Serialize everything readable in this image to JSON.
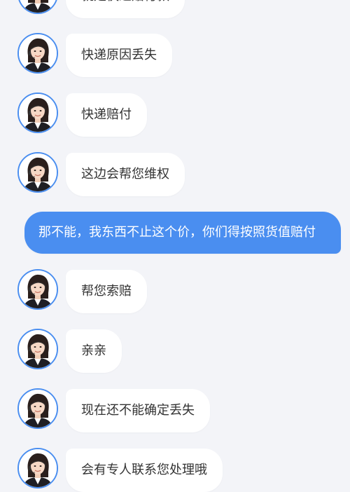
{
  "messages": [
    {
      "sender": "agent",
      "text": "就是快递赔付款"
    },
    {
      "sender": "agent",
      "text": "快递原因丢失"
    },
    {
      "sender": "agent",
      "text": "快递赔付"
    },
    {
      "sender": "agent",
      "text": "这边会帮您维权"
    },
    {
      "sender": "user",
      "text": "那不能，我东西不止这个价，你们得按照货值赔付"
    },
    {
      "sender": "agent",
      "text": "帮您索赔"
    },
    {
      "sender": "agent",
      "text": "亲亲"
    },
    {
      "sender": "agent",
      "text": "现在还不能确定丢失"
    },
    {
      "sender": "agent",
      "text": "会有专人联系您处理哦"
    }
  ],
  "avatar_icon": "customer-service-agent-avatar",
  "colors": {
    "background": "#f3f4f8",
    "agent_bubble": "#ffffff",
    "user_bubble": "#4a8ef0",
    "avatar_border": "#4a8ef0"
  }
}
